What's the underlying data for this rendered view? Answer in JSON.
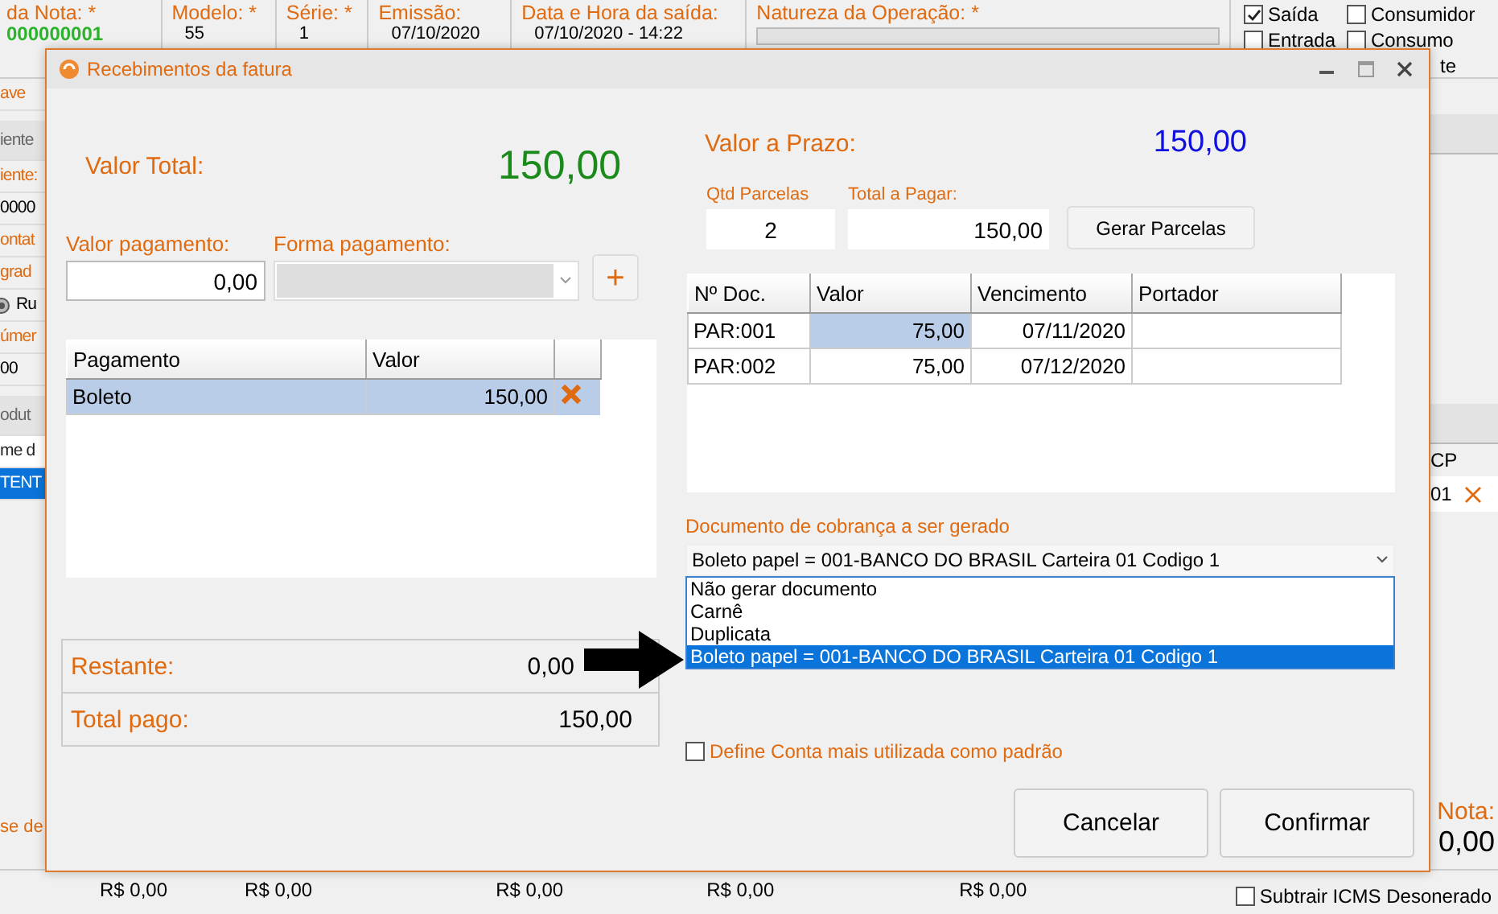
{
  "background": {
    "header_fields": [
      {
        "label": "da Nota: *",
        "value": "000000001",
        "kind": "number"
      },
      {
        "label": "Modelo: *",
        "value": "55",
        "kind": "text"
      },
      {
        "label": "Série: *",
        "value": "1",
        "kind": "text"
      },
      {
        "label": "Emissão:",
        "value": "07/10/2020",
        "kind": "text"
      },
      {
        "label": "Data e Hora da saída:",
        "value": "07/10/2020 - 14:22",
        "kind": "text"
      },
      {
        "label": "Natureza da Operação: *",
        "kind": "select"
      }
    ],
    "options": [
      {
        "label": "Saída",
        "checked": true
      },
      {
        "label": "Consumidor",
        "checked": false
      },
      {
        "label": "Entrada",
        "checked": false
      },
      {
        "label": "Consumo",
        "checked": false
      }
    ],
    "option_fragment": "te",
    "left_items": [
      {
        "kind": "label",
        "text": "ave"
      },
      {
        "kind": "section",
        "text": "iente"
      },
      {
        "kind": "label",
        "text": "iente:"
      },
      {
        "kind": "value",
        "text": "0000"
      },
      {
        "kind": "label",
        "text": "ontat"
      },
      {
        "kind": "label",
        "text": "grad"
      },
      {
        "kind": "icon_value",
        "text": "Ru"
      },
      {
        "kind": "label",
        "text": "úmer"
      },
      {
        "kind": "value",
        "text": "00"
      },
      {
        "kind": "section",
        "text": "odut"
      },
      {
        "kind": "header",
        "text": "me d"
      },
      {
        "kind": "selected",
        "text": "TENT"
      }
    ],
    "left_bottom": "se de",
    "right_header": "CP",
    "right_value": "01",
    "total_label": "Nota:",
    "total_value": "0,00",
    "amounts": [
      "R$ 0,00",
      "R$ 0,00",
      "R$ 0,00",
      "R$ 0,00",
      "R$ 0,00"
    ],
    "subtrair": {
      "label": "Subtrair ICMS Desonerado",
      "checked": false
    }
  },
  "dialog": {
    "title": "Recebimentos da fatura",
    "valor_total": {
      "label": "Valor Total:",
      "value": "150,00"
    },
    "valor_pagamento": {
      "label": "Valor pagamento:",
      "value": "0,00"
    },
    "forma_pagamento": {
      "label": "Forma pagamento:",
      "disabled": true
    },
    "add_button": "+",
    "payments": {
      "columns": [
        "Pagamento",
        "Valor"
      ],
      "rows": [
        {
          "pagamento": "Boleto",
          "valor": "150,00",
          "selected": true
        }
      ]
    },
    "summary": [
      {
        "label": "Restante:",
        "value": "0,00"
      },
      {
        "label": "Total pago:",
        "value": "150,00"
      }
    ],
    "valor_prazo": {
      "label": "Valor a Prazo:",
      "value": "150,00"
    },
    "qtd_parcelas": {
      "label": "Qtd Parcelas",
      "value": "2"
    },
    "total_pagar": {
      "label": "Total a Pagar:",
      "value": "150,00"
    },
    "gerar_button": "Gerar Parcelas",
    "parcelas": {
      "columns": [
        "Nº Doc.",
        "Valor",
        "Vencimento",
        "Portador"
      ],
      "rows": [
        {
          "doc": "PAR:001",
          "valor": "75,00",
          "vencimento": "07/11/2020",
          "selected": true
        },
        {
          "doc": "PAR:002",
          "valor": "75,00",
          "vencimento": "07/12/2020",
          "selected": false
        }
      ]
    },
    "documento": {
      "label": "Documento de cobrança a ser gerado",
      "value": "Boleto papel = 001-BANCO DO BRASIL Carteira 01 Codigo 1",
      "options": [
        {
          "label": "Não gerar documento",
          "selected": false
        },
        {
          "label": "Carnê",
          "selected": false
        },
        {
          "label": "Duplicata",
          "selected": false
        },
        {
          "label": "Boleto papel = 001-BANCO DO BRASIL Carteira 01 Codigo 1",
          "selected": true
        }
      ]
    },
    "define_padrao": {
      "label": "Define Conta mais utilizada como padrão",
      "checked": false
    },
    "buttons": [
      "Cancelar",
      "Confirmar"
    ]
  }
}
